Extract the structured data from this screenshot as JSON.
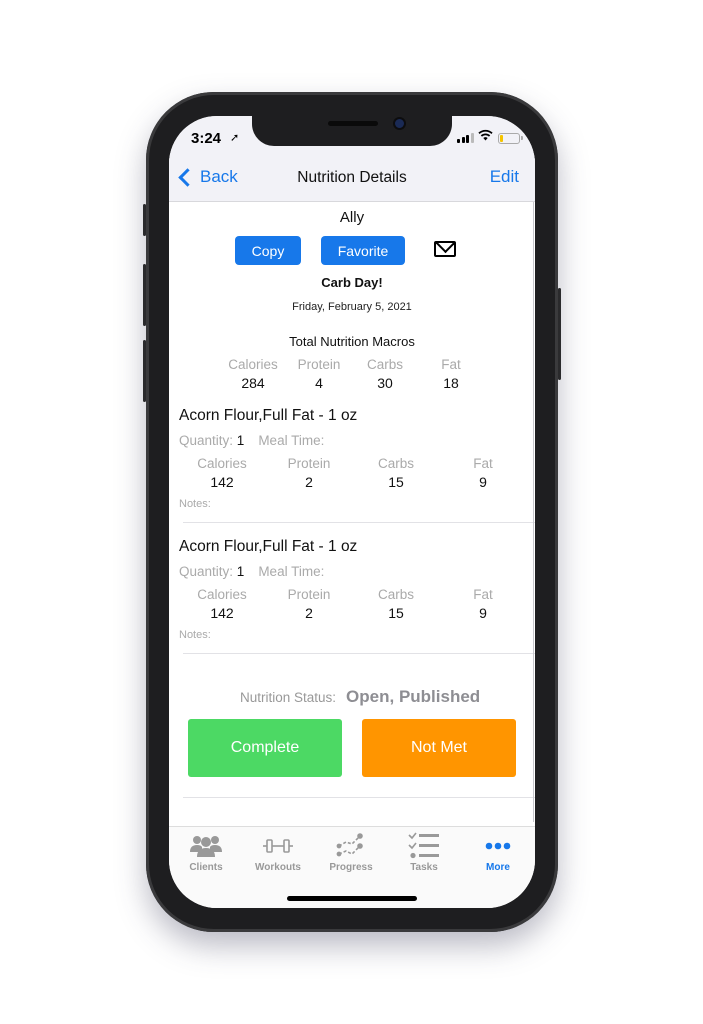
{
  "status_bar": {
    "time": "3:24"
  },
  "nav": {
    "back_label": "Back",
    "title": "Nutrition Details",
    "edit_label": "Edit"
  },
  "header": {
    "client_name": "Ally",
    "copy_label": "Copy",
    "favorite_label": "Favorite",
    "day_title": "Carb Day!",
    "date": "Friday, February 5, 2021"
  },
  "totals": {
    "title": "Total Nutrition Macros",
    "macros": [
      {
        "label": "Calories",
        "value": "284"
      },
      {
        "label": "Protein",
        "value": "4"
      },
      {
        "label": "Carbs",
        "value": "30"
      },
      {
        "label": "Fat",
        "value": "18"
      }
    ]
  },
  "items": [
    {
      "name": "Acorn Flour,Full Fat - 1 oz",
      "quantity_label": "Quantity:",
      "quantity": "1",
      "meal_time_label": "Meal Time:",
      "macros": [
        {
          "label": "Calories",
          "value": "142"
        },
        {
          "label": "Protein",
          "value": "2"
        },
        {
          "label": "Carbs",
          "value": "15"
        },
        {
          "label": "Fat",
          "value": "9"
        }
      ],
      "notes_label": "Notes:"
    },
    {
      "name": "Acorn Flour,Full Fat - 1 oz",
      "quantity_label": "Quantity:",
      "quantity": "1",
      "meal_time_label": "Meal Time:",
      "macros": [
        {
          "label": "Calories",
          "value": "142"
        },
        {
          "label": "Protein",
          "value": "2"
        },
        {
          "label": "Carbs",
          "value": "15"
        },
        {
          "label": "Fat",
          "value": "9"
        }
      ],
      "notes_label": "Notes:"
    }
  ],
  "status": {
    "label": "Nutrition Status:",
    "value": "Open, Published"
  },
  "actions": {
    "complete_label": "Complete",
    "not_met_label": "Not Met"
  },
  "colors": {
    "accent": "#1778ea",
    "complete": "#4cd964",
    "not_met": "#ff9500"
  },
  "tabs": [
    {
      "label": "Clients",
      "icon": "clients-icon"
    },
    {
      "label": "Workouts",
      "icon": "dumbbell-icon"
    },
    {
      "label": "Progress",
      "icon": "progress-icon"
    },
    {
      "label": "Tasks",
      "icon": "tasks-icon"
    },
    {
      "label": "More",
      "icon": "more-icon",
      "active": true
    }
  ]
}
